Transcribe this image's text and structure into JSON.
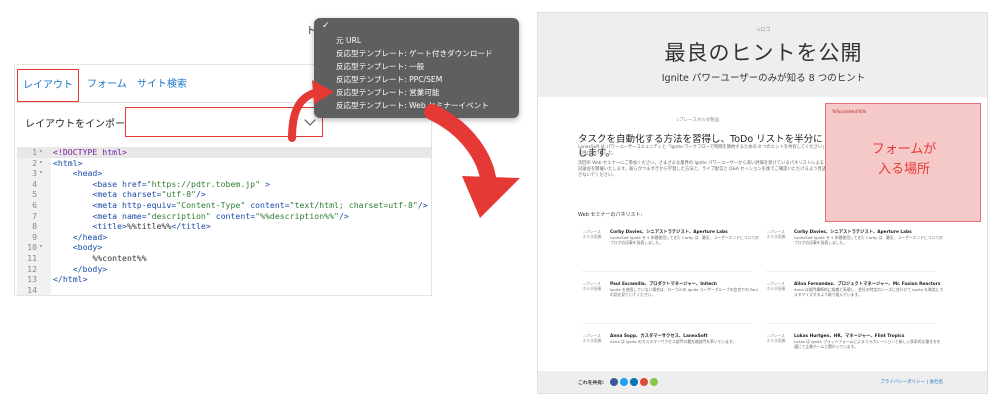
{
  "editor": {
    "tabs": [
      "レイアウト",
      "フォーム",
      "サイト検索"
    ],
    "import_label": "レイアウトをインポート",
    "code_lines": [
      {
        "n": "1",
        "fold": "▾",
        "parts": [
          [
            "t-kw",
            "<!DOCTYPE html>"
          ]
        ]
      },
      {
        "n": "2",
        "fold": "▾",
        "parts": [
          [
            "t-tag",
            "<html>"
          ]
        ]
      },
      {
        "n": "3",
        "fold": "▾",
        "parts": [
          [
            "",
            "    "
          ],
          [
            "t-tag",
            "<head>"
          ]
        ]
      },
      {
        "n": "4",
        "fold": "",
        "parts": [
          [
            "",
            "        "
          ],
          [
            "t-tag",
            "<base "
          ],
          [
            "t-attr",
            "href="
          ],
          [
            "t-str",
            "\"https://pdtr.tobem.jp\""
          ],
          [
            "t-tag",
            " >"
          ]
        ]
      },
      {
        "n": "5",
        "fold": "",
        "parts": [
          [
            "",
            "        "
          ],
          [
            "t-tag",
            "<meta "
          ],
          [
            "t-attr",
            "charset="
          ],
          [
            "t-str",
            "\"utf-8\""
          ],
          [
            "t-tag",
            "/>"
          ]
        ]
      },
      {
        "n": "6",
        "fold": "",
        "parts": [
          [
            "",
            "        "
          ],
          [
            "t-tag",
            "<meta "
          ],
          [
            "t-attr",
            "http-equiv="
          ],
          [
            "t-str",
            "\"Content-Type\""
          ],
          [
            "t-attr",
            " content="
          ],
          [
            "t-str",
            "\"text/html; charset=utf-8\""
          ],
          [
            "t-tag",
            "/>"
          ]
        ]
      },
      {
        "n": "7",
        "fold": "",
        "parts": [
          [
            "",
            "        "
          ],
          [
            "t-tag",
            "<meta "
          ],
          [
            "t-attr",
            "name="
          ],
          [
            "t-str",
            "\"description\""
          ],
          [
            "t-attr",
            " content="
          ],
          [
            "t-str",
            "\"%%description%%\""
          ],
          [
            "t-tag",
            "/>"
          ]
        ]
      },
      {
        "n": "8",
        "fold": "",
        "parts": [
          [
            "",
            "        "
          ],
          [
            "t-tag",
            "<title>"
          ],
          [
            "",
            "%%title%%"
          ],
          [
            "t-tag",
            "</title>"
          ]
        ]
      },
      {
        "n": "9",
        "fold": "",
        "parts": [
          [
            "",
            "    "
          ],
          [
            "t-tag",
            "</head>"
          ]
        ]
      },
      {
        "n": "10",
        "fold": "▾",
        "parts": [
          [
            "",
            "    "
          ],
          [
            "t-tag",
            "<body>"
          ]
        ]
      },
      {
        "n": "11",
        "fold": "",
        "parts": [
          [
            "",
            "        %%content%%"
          ]
        ]
      },
      {
        "n": "12",
        "fold": "",
        "parts": [
          [
            "",
            "    "
          ],
          [
            "t-tag",
            "</body>"
          ]
        ]
      },
      {
        "n": "13",
        "fold": "",
        "parts": [
          [
            "t-tag",
            "</html>"
          ]
        ]
      },
      {
        "n": "14",
        "fold": "",
        "parts": [
          [
            "",
            ""
          ]
        ]
      }
    ]
  },
  "dropdown": {
    "stray_glyph": "ト",
    "items": [
      "元 URL",
      "反応型テンプレート: ゲート付きダウンロード",
      "反応型テンプレート: 一般",
      "反応型テンプレート: PPC/SEM",
      "反応型テンプレート: 営業可能",
      "反応型テンプレート: Web セミナーイベント"
    ]
  },
  "preview": {
    "logo": "ロゴ",
    "title": "最良のヒントを公開",
    "subtitle": "Ignite パワーユーザーのみが知る 8 つのヒント",
    "image_placeholder": "プレースホルダ製品",
    "section_title": "タスクを自動化する方法を習得し、ToDo リストを半分にします。",
    "para1": "LanexSoft は パワーユーザーコミュニティと「Ignite ワークフローで時間を節約するための 8 つのヒントを共有してください」と呼びかけました。",
    "para2": "次回の Web セミナーにご参加ください。さまざまな業界の Ignite パワーユーザーから高い評価を受けているパネリストによる討論会を開催いたします。彼らがつまずきから学習した方法と、ライブ配信と Q&A セッションを後でご確認いただけるよう見逃さないでください。",
    "form_tag": "%%content%%",
    "form_caption": "フォームが\n入る場所",
    "panel_heading": "Web セミナーのパネリスト:",
    "speaker_placeholder": "プレースホルダ画像",
    "speakers": [
      {
        "name": "Corby Davies、シニアストラテジスト、Aperture Labs",
        "bio": "LanexSoft Ignite を 5 年間使用してきた Corby は、最近、ユーザーエンドについてのブログの記事を発表しました。"
      },
      {
        "name": "Corby Davies、シニアストラテジスト、Aperture Labs",
        "bio": "LanexSoft Ignite を 5 年間使用してきた Corby は、最近、ユーザーエンドについてのブログの記事を発表しました。"
      },
      {
        "name": "Paul Escamilla、プロダクトマネージャー、Initech",
        "bio": "Ignite を使用していない場合は、ローカルの Ignite ユーザーグループの会合での Paul の話を見ていてください。"
      },
      {
        "name": "Alina Fernandez、プロジェクトマネージャー、Mr. Fusion Reactors",
        "bio": "Anna は部門横断的に組織と表現し、会社の特定のニーズに合わせて Ignite を微笑にカスタマイズするよう取り組んでいます。"
      },
      {
        "name": "Anna Sopp、カスタマーサクセス、LanexSoft",
        "bio": "Anna は Ignite のカスタマーサクセス部門の最先端部門を率いています。"
      },
      {
        "name": "Lukas Hurtgen、HR、マネージャー、Flint Tropics",
        "bio": "Lukas は Ignite プラットフォームによるコラボレーションと新しい多彩的な働き方を通じて企業チームと関わっています。"
      }
    ],
    "share_label": "これを共有:",
    "share_colors": [
      "#3b5998",
      "#1da1f2",
      "#0077b5",
      "#dd4b39",
      "#8bc34a"
    ],
    "footer_links": "プライバシーポリシー | 会社名"
  }
}
